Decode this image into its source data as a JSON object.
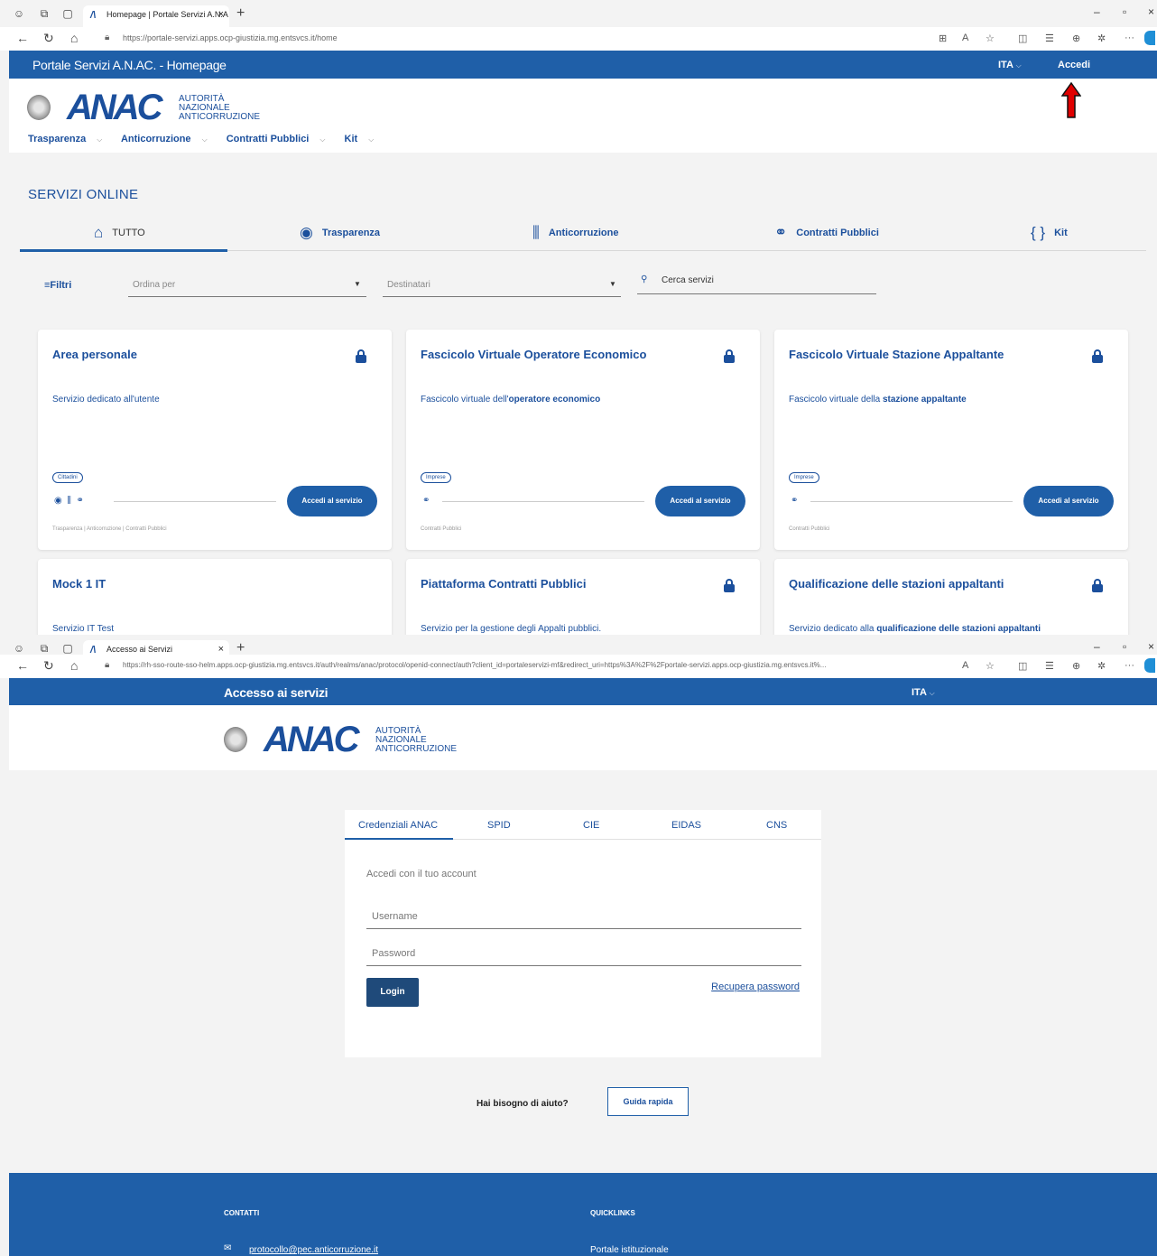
{
  "shot1": {
    "tab_title": "Homepage | Portale Servizi A.N.A",
    "url": "https://portale-servizi.apps.ocp-giustizia.mg.entsvcs.it/home",
    "portal_title": "Portale Servizi A.N.AC. - Homepage",
    "lang": "ITA",
    "login_link": "Accedi",
    "logo": {
      "word": "ANAC",
      "line1": "AUTORITÀ",
      "line2": "NAZIONALE",
      "line3": "ANTICORRUZIONE"
    },
    "menu": [
      "Trasparenza",
      "Anticorruzione",
      "Contratti Pubblici",
      "Kit"
    ],
    "section_title": "SERVIZI ONLINE",
    "categories": [
      {
        "label": "TUTTO",
        "icon": "home-icon"
      },
      {
        "label": "Trasparenza",
        "icon": "eye-icon"
      },
      {
        "label": "Anticorruzione",
        "icon": "column-icon"
      },
      {
        "label": "Contratti Pubblici",
        "icon": "handshake-icon"
      },
      {
        "label": "Kit",
        "icon": "braces-icon"
      }
    ],
    "filters": {
      "label": "Filtri",
      "order_placeholder": "Ordina per",
      "recipients_placeholder": "Destinatari",
      "search_placeholder": "Cerca servizi"
    },
    "cards": [
      {
        "title": "Area personale",
        "desc": "Servizio dedicato all'utente",
        "desc_bold": "",
        "tag": "Cittadini",
        "button": "Accedi al servizio",
        "footer": "Trasparenza | Anticorruzione | Contratti Pubblici"
      },
      {
        "title": "Fascicolo Virtuale Operatore Economico",
        "desc": "Fascicolo virtuale dell'",
        "desc_bold": "operatore economico",
        "tag": "Imprese",
        "button": "Accedi al servizio",
        "footer": "Contratti Pubblici"
      },
      {
        "title": "Fascicolo Virtuale Stazione Appaltante",
        "desc": "Fascicolo virtuale della ",
        "desc_bold": "stazione appaltante",
        "tag": "Imprese",
        "button": "Accedi al servizio",
        "footer": "Contratti Pubblici"
      },
      {
        "title": "Mock 1 IT",
        "desc": "Servizio IT Test",
        "desc_bold": ""
      },
      {
        "title": "Piattaforma Contratti Pubblici",
        "desc": "Servizio per la gestione degli Appalti pubblici.",
        "desc_bold": ""
      },
      {
        "title": "Qualificazione delle stazioni appaltanti",
        "desc": "Servizio dedicato alla ",
        "desc_bold": "qualificazione delle stazioni appaltanti"
      }
    ]
  },
  "shot2": {
    "tab_title": "Accesso ai Servizi",
    "url": "https://rh-sso-route-sso-helm.apps.ocp-giustizia.mg.entsvcs.it/auth/realms/anac/protocol/openid-connect/auth?client_id=portaleservizi-mf&redirect_uri=https%3A%2F%2Fportale-servizi.apps.ocp-giustizia.mg.entsvcs.it%...",
    "portal_title": "Accesso ai servizi",
    "lang": "ITA",
    "login_tabs": [
      "Credenziali ANAC",
      "SPID",
      "CIE",
      "EIDAS",
      "CNS"
    ],
    "hint": "Accedi con il tuo account",
    "username_placeholder": "Username",
    "password_placeholder": "Password",
    "login_button": "Login",
    "recover_link": "Recupera password",
    "help_text": "Hai bisogno di aiuto?",
    "guide_button": "Guida rapida",
    "footer": {
      "contacts_title": "CONTATTI",
      "email": "protocollo@pec.anticorruzione.it",
      "quicklinks_title": "QUICKLINKS",
      "quicklink": "Portale istituzionale"
    }
  },
  "colors": {
    "brand_blue": "#1f5fa8",
    "text_blue": "#1b4f9c",
    "arrow_red": "#e00000"
  }
}
